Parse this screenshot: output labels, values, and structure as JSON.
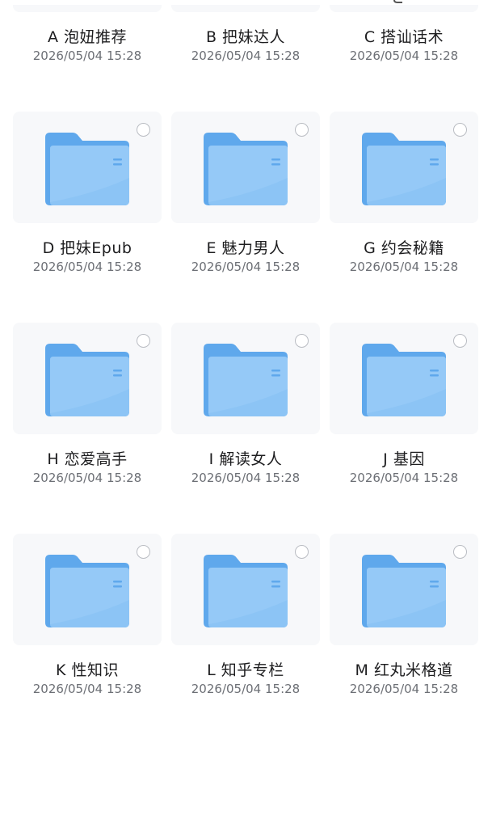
{
  "folders": [
    {
      "name": "A 泡妞推荐",
      "date": "2026/05/04 15:28"
    },
    {
      "name": "B 把妹达人",
      "date": "2026/05/04 15:28"
    },
    {
      "name": "C 搭讪话术",
      "date": "2026/05/04 15:28"
    },
    {
      "name": "D 把妹Epub",
      "date": "2026/05/04 15:28"
    },
    {
      "name": "E 魅力男人",
      "date": "2026/05/04 15:28"
    },
    {
      "name": "G 约会秘籍",
      "date": "2026/05/04 15:28"
    },
    {
      "name": "H 恋爱高手",
      "date": "2026/05/04 15:28"
    },
    {
      "name": "I 解读女人",
      "date": "2026/05/04 15:28"
    },
    {
      "name": "J 基因",
      "date": "2026/05/04 15:28"
    },
    {
      "name": "K 性知识",
      "date": "2026/05/04 15:28"
    },
    {
      "name": "L 知乎专栏",
      "date": "2026/05/04 15:28"
    },
    {
      "name": "M 红丸米格道",
      "date": "2026/05/04 15:28"
    }
  ],
  "icons": {
    "folder": "folder-icon",
    "select": "selection-circle-icon"
  },
  "colors": {
    "folder_back": "#5fa8ec",
    "folder_front": "#8cc4f5",
    "tile_bg": "#f7f8fa",
    "name_text": "#1d1d1f",
    "date_text": "#6c6f75"
  }
}
